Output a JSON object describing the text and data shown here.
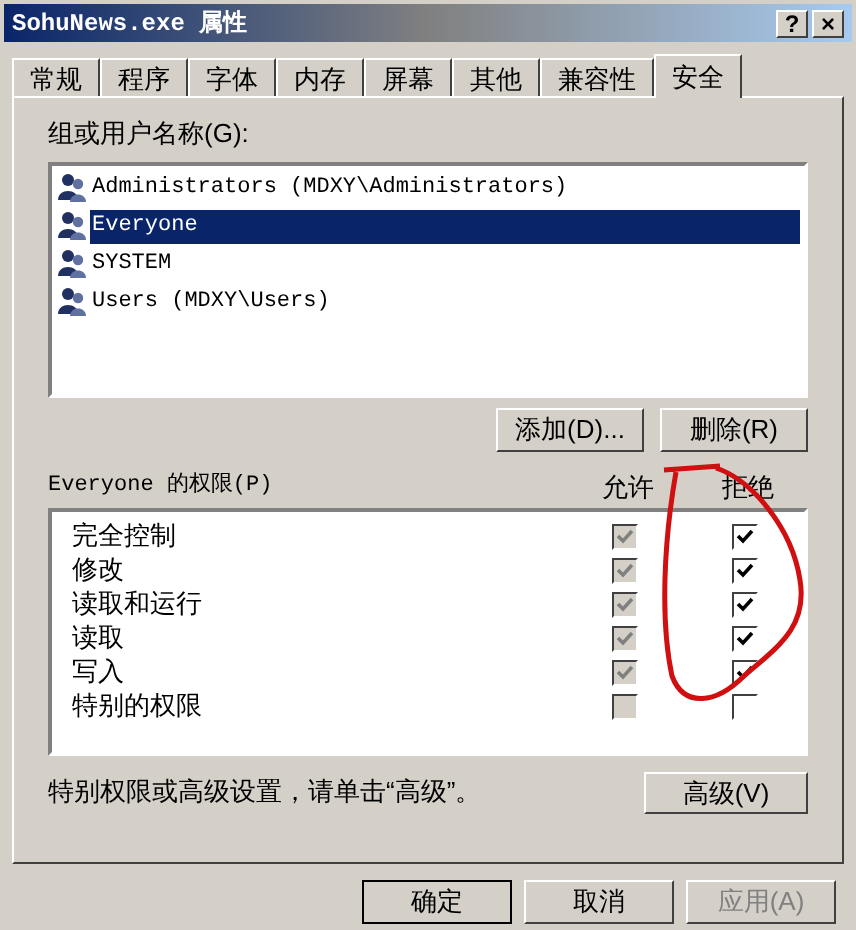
{
  "window": {
    "title": "SohuNews.exe 属性",
    "help_button": "?",
    "close_button": "×"
  },
  "tabs": [
    {
      "label": "常规",
      "selected": false
    },
    {
      "label": "程序",
      "selected": false
    },
    {
      "label": "字体",
      "selected": false
    },
    {
      "label": "内存",
      "selected": false
    },
    {
      "label": "屏幕",
      "selected": false
    },
    {
      "label": "其他",
      "selected": false
    },
    {
      "label": "兼容性",
      "selected": false
    },
    {
      "label": "安全",
      "selected": true
    }
  ],
  "users_label": "组或用户名称(G):",
  "users": [
    {
      "name": "Administrators (MDXY\\Administrators)",
      "selected": false
    },
    {
      "name": "Everyone",
      "selected": true
    },
    {
      "name": "SYSTEM",
      "selected": false
    },
    {
      "name": "Users (MDXY\\Users)",
      "selected": false
    }
  ],
  "user_buttons": [
    "添加(D)...",
    "删除(R)"
  ],
  "permissions_label": "Everyone 的权限(P)",
  "columns": [
    "允许",
    "拒绝"
  ],
  "permissions": [
    {
      "name": "完全控制",
      "allow": true,
      "allow_disabled": true,
      "deny": true
    },
    {
      "name": "修改",
      "allow": true,
      "allow_disabled": true,
      "deny": true
    },
    {
      "name": "读取和运行",
      "allow": true,
      "allow_disabled": true,
      "deny": true
    },
    {
      "name": "读取",
      "allow": true,
      "allow_disabled": true,
      "deny": true
    },
    {
      "name": "写入",
      "allow": true,
      "allow_disabled": true,
      "deny": true
    },
    {
      "name": "特别的权限",
      "allow": false,
      "allow_disabled": true,
      "deny": false
    }
  ],
  "hint": "特别权限或高级设置，请单击“高级”。",
  "advanced_button": "高级(V)",
  "buttons": [
    {
      "label": "确定",
      "disabled": false,
      "default": true
    },
    {
      "label": "取消",
      "disabled": false,
      "default": false
    },
    {
      "label": "应用(A)",
      "disabled": true,
      "default": false
    }
  ]
}
